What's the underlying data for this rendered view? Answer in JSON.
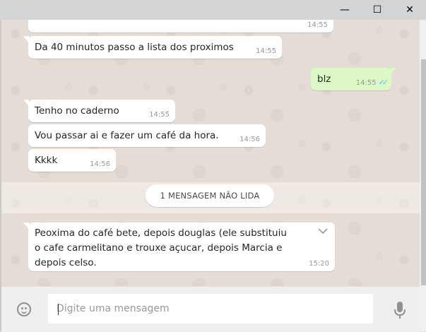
{
  "window": {
    "minimize_glyph": "—",
    "maximize_glyph": "☐",
    "close_glyph": "✕"
  },
  "messages": [
    {
      "text": "",
      "time": "14:55",
      "direction": "in"
    },
    {
      "text": "Da 40 minutos passo a lista dos proximos",
      "time": "14:55",
      "direction": "in"
    },
    {
      "text": "blz",
      "time": "14:55",
      "direction": "out",
      "status": "read"
    },
    {
      "text": "Tenho no caderno",
      "time": "14:55",
      "direction": "in"
    },
    {
      "text": "Vou passar ai e fazer um café da hora.",
      "time": "14:56",
      "direction": "in"
    },
    {
      "text": "Kkkk",
      "time": "14:56",
      "direction": "in"
    },
    {
      "text": "Peoxima do café bete, depois douglas (ele substituiu o cafe carmelitano e trouxe açucar, depois Marcia e depois celso.",
      "time": "15:20",
      "direction": "in"
    }
  ],
  "unread_label": "1 MENSAGEM NÃO LIDA",
  "composer": {
    "placeholder": "Digite uma mensagem",
    "emoji_icon": "emoji-icon",
    "mic_icon": "mic-icon"
  },
  "colors": {
    "background": "#e5ddd5",
    "incoming": "#ffffff",
    "outgoing": "#dcf8c6",
    "read_ticks": "#4fc3f7"
  }
}
